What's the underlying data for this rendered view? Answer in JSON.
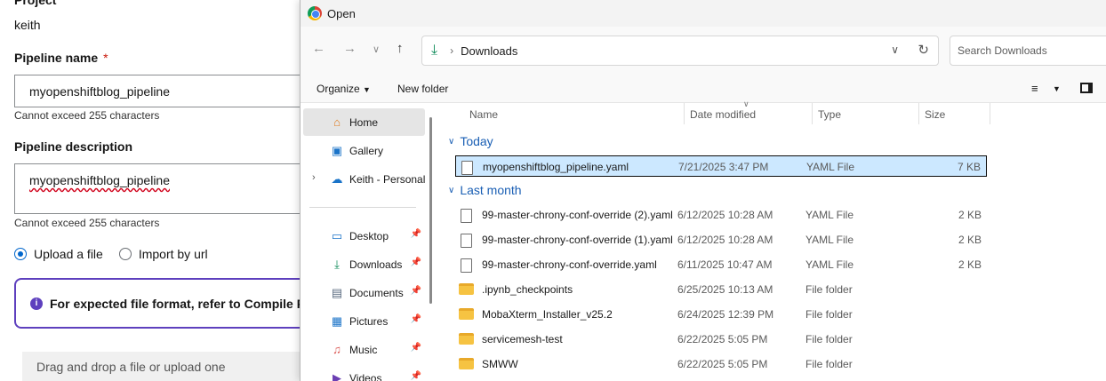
{
  "form": {
    "project_label": "Project",
    "project_value": "keith",
    "pipeline_name_label": "Pipeline name",
    "required_marker": "*",
    "pipeline_name_value": "myopenshiftblog_pipeline",
    "pipeline_name_help": "Cannot exceed 255 characters",
    "pipeline_desc_label": "Pipeline description",
    "pipeline_desc_value": "myopenshiftblog_pipeline",
    "pipeline_desc_help": "Cannot exceed 255 characters",
    "radio_upload": "Upload a file",
    "radio_import": "Import by url",
    "alert_text": "For expected file format, refer to Compile P",
    "dropzone_text": "Drag and drop a file or upload one"
  },
  "dialog": {
    "title": "Open",
    "address": {
      "location": "Downloads"
    },
    "search_placeholder": "Search Downloads",
    "organize_label": "Organize",
    "new_folder_label": "New folder",
    "sidebar": [
      {
        "label": "Home",
        "icon": "home-icon",
        "selected": true
      },
      {
        "label": "Gallery",
        "icon": "gallery-icon"
      },
      {
        "label": "Keith - Personal",
        "icon": "cloud-icon",
        "expandable": true
      },
      {
        "label": "Desktop",
        "icon": "desktop-icon",
        "pinned": true
      },
      {
        "label": "Downloads",
        "icon": "download-icon",
        "pinned": true
      },
      {
        "label": "Documents",
        "icon": "documents-icon",
        "pinned": true
      },
      {
        "label": "Pictures",
        "icon": "pictures-icon",
        "pinned": true
      },
      {
        "label": "Music",
        "icon": "music-icon",
        "pinned": true
      },
      {
        "label": "Videos",
        "icon": "videos-icon",
        "pinned": true
      }
    ],
    "columns": {
      "name": "Name",
      "date": "Date modified",
      "type": "Type",
      "size": "Size"
    },
    "groups": {
      "today": "Today",
      "last_month": "Last month"
    },
    "files": [
      {
        "name": "myopenshiftblog_pipeline.yaml",
        "date": "7/21/2025 3:47 PM",
        "type": "YAML File",
        "size": "7 KB",
        "kind": "file",
        "selected": true
      },
      {
        "name": "99-master-chrony-conf-override (2).yaml",
        "date": "6/12/2025 10:28 AM",
        "type": "YAML File",
        "size": "2 KB",
        "kind": "file"
      },
      {
        "name": "99-master-chrony-conf-override (1).yaml",
        "date": "6/12/2025 10:28 AM",
        "type": "YAML File",
        "size": "2 KB",
        "kind": "file"
      },
      {
        "name": "99-master-chrony-conf-override.yaml",
        "date": "6/11/2025 10:47 AM",
        "type": "YAML File",
        "size": "2 KB",
        "kind": "file"
      },
      {
        "name": ".ipynb_checkpoints",
        "date": "6/25/2025 10:13 AM",
        "type": "File folder",
        "size": "",
        "kind": "folder"
      },
      {
        "name": "MobaXterm_Installer_v25.2",
        "date": "6/24/2025 12:39 PM",
        "type": "File folder",
        "size": "",
        "kind": "folder"
      },
      {
        "name": "servicemesh-test",
        "date": "6/22/2025 5:05 PM",
        "type": "File folder",
        "size": "",
        "kind": "folder"
      },
      {
        "name": "SMWW",
        "date": "6/22/2025 5:05 PM",
        "type": "File folder",
        "size": "",
        "kind": "folder"
      }
    ]
  }
}
